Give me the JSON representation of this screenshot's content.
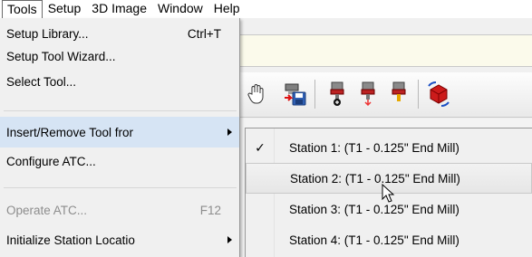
{
  "menubar": {
    "items": [
      "Tools",
      "Setup",
      "3D Image",
      "Window",
      "Help"
    ]
  },
  "tools_menu": {
    "items": [
      {
        "label": "Setup Library...",
        "shortcut": "Ctrl+T"
      },
      {
        "label": "Setup Tool Wizard...",
        "shortcut": ""
      },
      {
        "label": "Select Tool...",
        "shortcut": ""
      },
      {
        "label": "Insert/Remove Tool fror",
        "shortcut": ""
      },
      {
        "label": "Configure ATC...",
        "shortcut": ""
      },
      {
        "label": "Operate ATC...",
        "shortcut": "F12"
      },
      {
        "label": "Initialize Station Locatio",
        "shortcut": ""
      }
    ]
  },
  "submenu": {
    "check_glyph": "✓",
    "items": [
      {
        "label": "Station 1: (T1 - 0.125\" End Mill)",
        "checked": true
      },
      {
        "label": "Station 2: (T1 - 0.125\" End Mill)",
        "checked": false
      },
      {
        "label": "Station 3: (T1 - 0.125\" End Mill)",
        "checked": false
      },
      {
        "label": "Station 4: (T1 - 0.125\" End Mill)",
        "checked": false
      }
    ]
  },
  "toolbar": {
    "icons": [
      "hand-pan-icon",
      "save-tool-icon",
      "tool-spindle-icon",
      "tool-spindle-red-icon",
      "red-cube-rotate-icon"
    ]
  },
  "colors": {
    "menu_bg": "#f0f0f0",
    "highlight": "#d6e4f4",
    "disabled_text": "#8d8d8d"
  }
}
